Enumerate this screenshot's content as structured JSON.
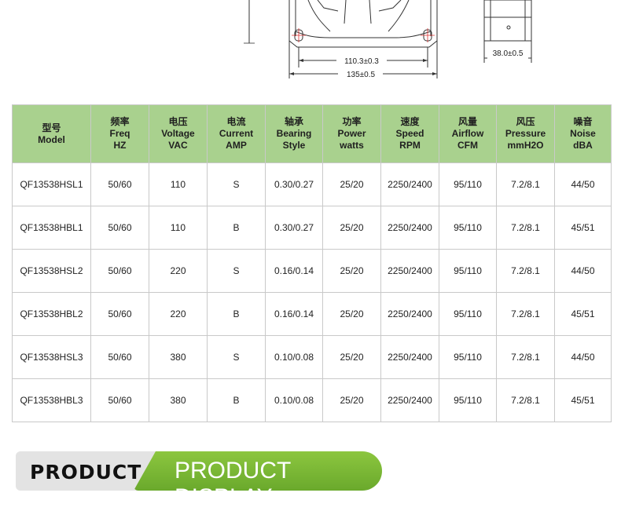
{
  "drawing": {
    "dim_inner": "110.3±0.3",
    "dim_outer": "135±0.5",
    "dim_depth": "38.0±0.5"
  },
  "table": {
    "headers": [
      {
        "cn": "型号",
        "en1": "Model",
        "en2": ""
      },
      {
        "cn": "频率",
        "en1": "Freq",
        "en2": "HZ"
      },
      {
        "cn": "电压",
        "en1": "Voltage",
        "en2": "VAC"
      },
      {
        "cn": "电流",
        "en1": "Current",
        "en2": "AMP"
      },
      {
        "cn": "轴承",
        "en1": "Bearing",
        "en2": "Style"
      },
      {
        "cn": "功率",
        "en1": "Power",
        "en2": "watts"
      },
      {
        "cn": "速度",
        "en1": "Speed",
        "en2": "RPM"
      },
      {
        "cn": "风量",
        "en1": "Airflow",
        "en2": "CFM"
      },
      {
        "cn": "风压",
        "en1": "Pressure",
        "en2": "mmH2O"
      },
      {
        "cn": "噪音",
        "en1": "Noise",
        "en2": "dBA"
      }
    ],
    "rows": [
      [
        "QF13538HSL1",
        "50/60",
        "110",
        "S",
        "0.30/0.27",
        "25/20",
        "2250/2400",
        "95/110",
        "7.2/8.1",
        "44/50"
      ],
      [
        "QF13538HBL1",
        "50/60",
        "110",
        "B",
        "0.30/0.27",
        "25/20",
        "2250/2400",
        "95/110",
        "7.2/8.1",
        "45/51"
      ],
      [
        "QF13538HSL2",
        "50/60",
        "220",
        "S",
        "0.16/0.14",
        "25/20",
        "2250/2400",
        "95/110",
        "7.2/8.1",
        "44/50"
      ],
      [
        "QF13538HBL2",
        "50/60",
        "220",
        "B",
        "0.16/0.14",
        "25/20",
        "2250/2400",
        "95/110",
        "7.2/8.1",
        "45/51"
      ],
      [
        "QF13538HSL3",
        "50/60",
        "380",
        "S",
        "0.10/0.08",
        "25/20",
        "2250/2400",
        "95/110",
        "7.2/8.1",
        "44/50"
      ],
      [
        "QF13538HBL3",
        "50/60",
        "380",
        "B",
        "0.10/0.08",
        "25/20",
        "2250/2400",
        "95/110",
        "7.2/8.1",
        "45/51"
      ]
    ]
  },
  "banner": {
    "left_label": "PRODUCT",
    "right_label": "PRODUCT DISPLAY"
  },
  "colors": {
    "header_bg": "#a9d18e",
    "banner_green": "#7ab835",
    "banner_gray": "#e3e3e3"
  }
}
